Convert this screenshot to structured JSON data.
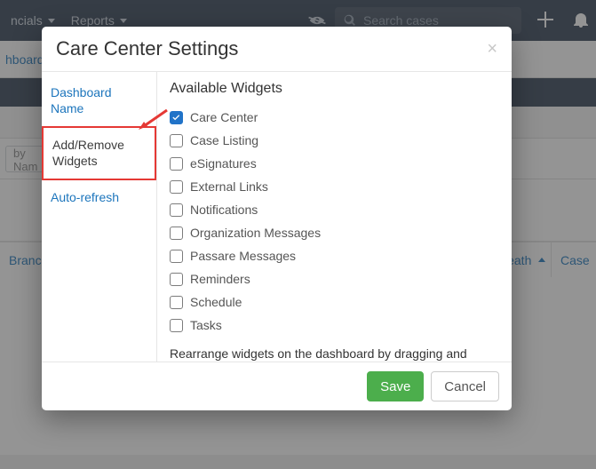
{
  "background": {
    "nav": [
      {
        "label": "ncials"
      },
      {
        "label": "Reports"
      }
    ],
    "search_placeholder": "Search cases",
    "crumbs": {
      "first": "hboard"
    },
    "filter_label": "by Nam",
    "cols": {
      "branch": "Branch",
      "death": "Death",
      "case": "Case"
    }
  },
  "modal": {
    "title": "Care Center Settings",
    "tabs": [
      "Dashboard Name",
      "Add/Remove Widgets",
      "Auto-refresh"
    ],
    "active_tab_index": 1,
    "panel_title": "Available Widgets",
    "widgets": [
      {
        "label": "Care Center",
        "checked": true
      },
      {
        "label": "Case Listing",
        "checked": false
      },
      {
        "label": "eSignatures",
        "checked": false
      },
      {
        "label": "External Links",
        "checked": false
      },
      {
        "label": "Notifications",
        "checked": false
      },
      {
        "label": "Organization Messages",
        "checked": false
      },
      {
        "label": "Passare Messages",
        "checked": false
      },
      {
        "label": "Reminders",
        "checked": false
      },
      {
        "label": "Schedule",
        "checked": false
      },
      {
        "label": "Tasks",
        "checked": false
      }
    ],
    "hint": "Rearrange widgets on the dashboard by dragging and dropping them.",
    "save_label": "Save",
    "cancel_label": "Cancel"
  }
}
